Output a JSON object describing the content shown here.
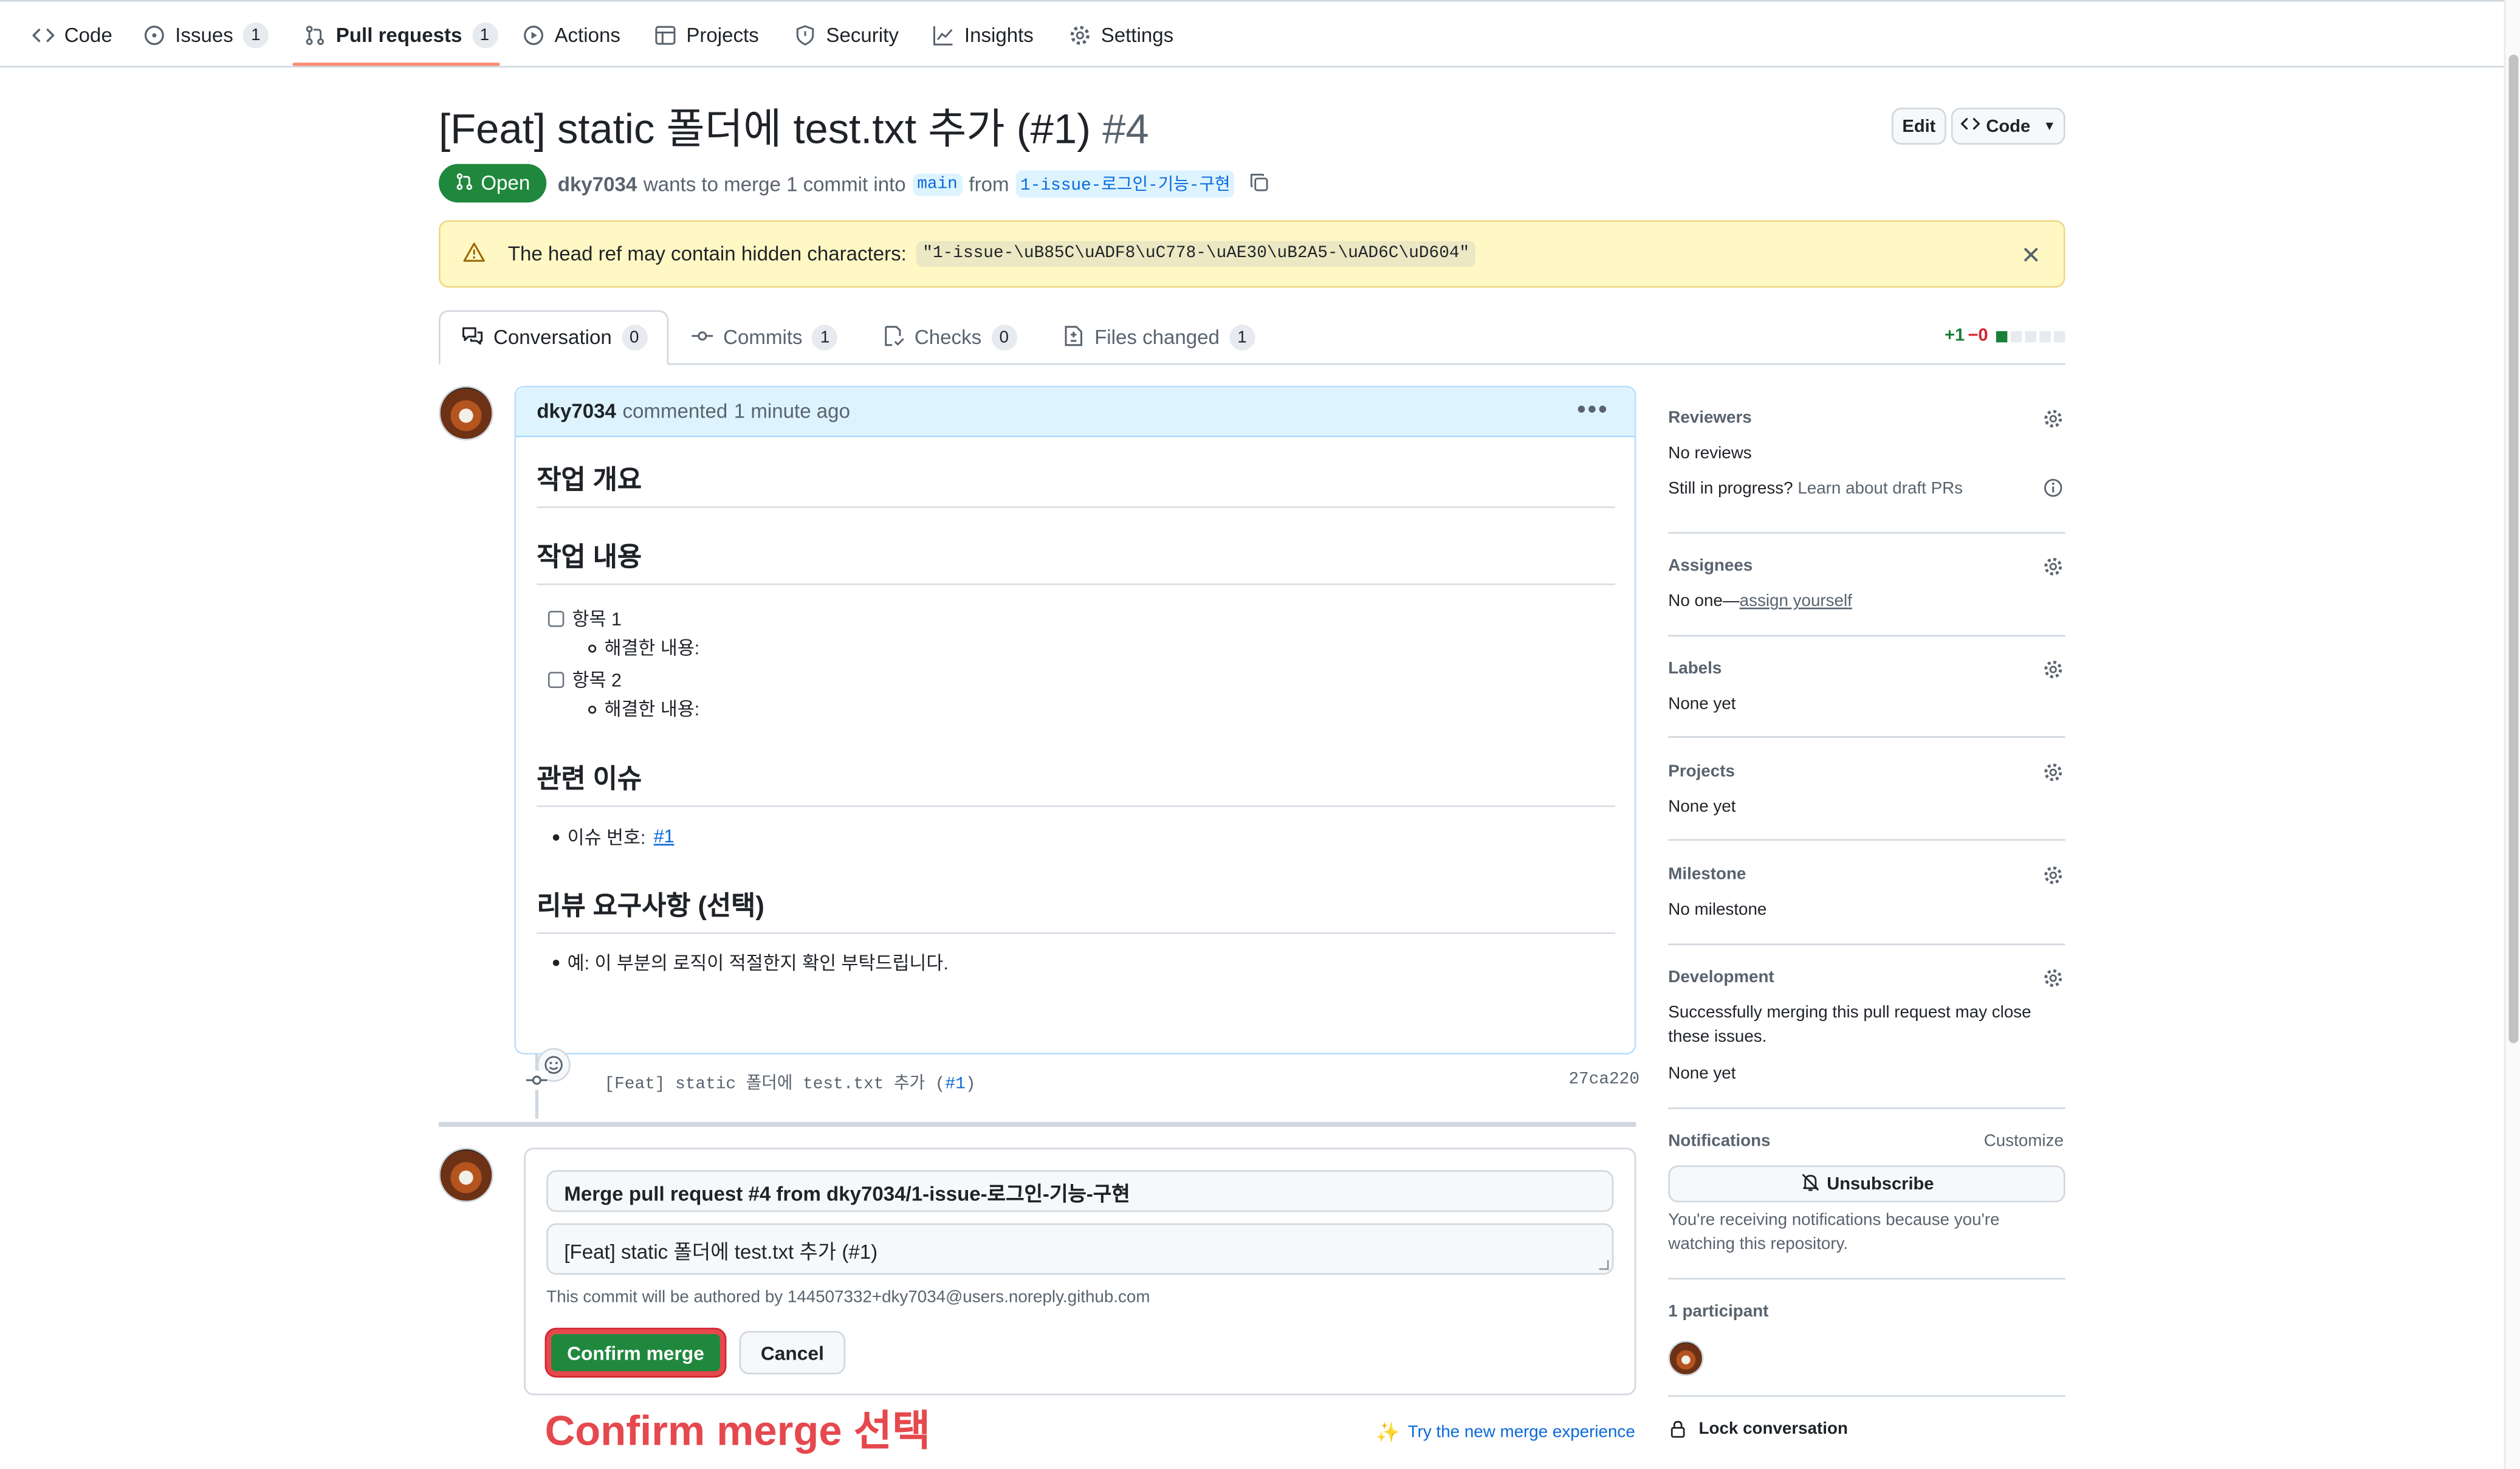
{
  "repo_nav": {
    "tabs": [
      {
        "label": "Code",
        "icon": "code-icon"
      },
      {
        "label": "Issues",
        "icon": "issue-opened-icon",
        "count": "1"
      },
      {
        "label": "Pull requests",
        "icon": "git-pull-request-icon",
        "count": "1",
        "active": true
      },
      {
        "label": "Actions",
        "icon": "play-icon"
      },
      {
        "label": "Projects",
        "icon": "table-icon"
      },
      {
        "label": "Security",
        "icon": "shield-icon"
      },
      {
        "label": "Insights",
        "icon": "graph-icon"
      },
      {
        "label": "Settings",
        "icon": "gear-icon"
      }
    ]
  },
  "header": {
    "title": "[Feat] static 폴더에 test.txt 추가 (#1)",
    "number": "#4",
    "edit_label": "Edit",
    "code_label": "Code",
    "state": "Open",
    "author": "dky7034",
    "merge_text": "wants to merge 1 commit into",
    "base_branch": "main",
    "from_text": "from",
    "head_branch": "1-issue-로그인-기능-구현"
  },
  "flash": {
    "text": "The head ref may contain hidden characters:",
    "code": "\"1-issue-\\uB85C\\uADF8\\uC778-\\uAE30\\uB2A5-\\uAD6C\\uD604\""
  },
  "pr_tabs": [
    {
      "label": "Conversation",
      "count": "0",
      "icon": "comment-discussion-icon"
    },
    {
      "label": "Commits",
      "count": "1",
      "icon": "git-commit-icon"
    },
    {
      "label": "Checks",
      "count": "0",
      "icon": "checklist-icon"
    },
    {
      "label": "Files changed",
      "count": "1",
      "icon": "file-diff-icon"
    }
  ],
  "diffstat": {
    "additions": "+1",
    "deletions": "−0",
    "add_color": "#1a7f37",
    "del_color": "#d1242f"
  },
  "comment": {
    "author": "dky7034",
    "action": "commented",
    "time": "1 minute ago",
    "h_overview": "작업 개요",
    "h_content": "작업 내용",
    "item1": "항목 1",
    "item1_sub": "해결한 내용:",
    "item2": "항목 2",
    "item2_sub": "해결한 내용:",
    "h_issue": "관련 이슈",
    "issue_label": "이슈 번호:",
    "issue_link": "#1",
    "h_review": "리뷰 요구사항 (선택)",
    "review_text": "예: 이 부분의 로직이 적절한지 확인 부탁드립니다."
  },
  "commit": {
    "message": "[Feat] static 폴더에 test.txt 추가 (",
    "ref": "#1",
    "close": ")",
    "sha": "27ca220"
  },
  "merge": {
    "title_value": "Merge pull request #4 from dky7034/1-issue-로그인-기능-구현",
    "body_value": "[Feat] static 폴더에 test.txt 추가 (#1)",
    "author_note": "This commit will be authored by 144507332+dky7034@users.noreply.github.com",
    "confirm_label": "Confirm merge",
    "cancel_label": "Cancel",
    "annotation": "Confirm merge 선택",
    "try_new": "Try the new merge experience",
    "accent": "#1f883d",
    "highlight": "#e5484d"
  },
  "sidebar": {
    "reviewers_title": "Reviewers",
    "reviewers_value": "No reviews",
    "draft_prefix": "Still in progress?",
    "draft_link": "Learn about draft PRs",
    "assignees_title": "Assignees",
    "assignees_prefix": "No one—",
    "assignees_link": "assign yourself",
    "labels_title": "Labels",
    "labels_value": "None yet",
    "projects_title": "Projects",
    "projects_value": "None yet",
    "milestone_title": "Milestone",
    "milestone_value": "No milestone",
    "development_title": "Development",
    "development_line1": "Successfully merging this pull request may close",
    "development_line2": "these issues.",
    "development_value": "None yet",
    "notifications_title": "Notifications",
    "customize": "Customize",
    "unsubscribe": "Unsubscribe",
    "notif_line1": "You're receiving notifications because you're",
    "notif_line2": "watching this repository.",
    "participants": "1 participant",
    "lock": "Lock conversation"
  }
}
